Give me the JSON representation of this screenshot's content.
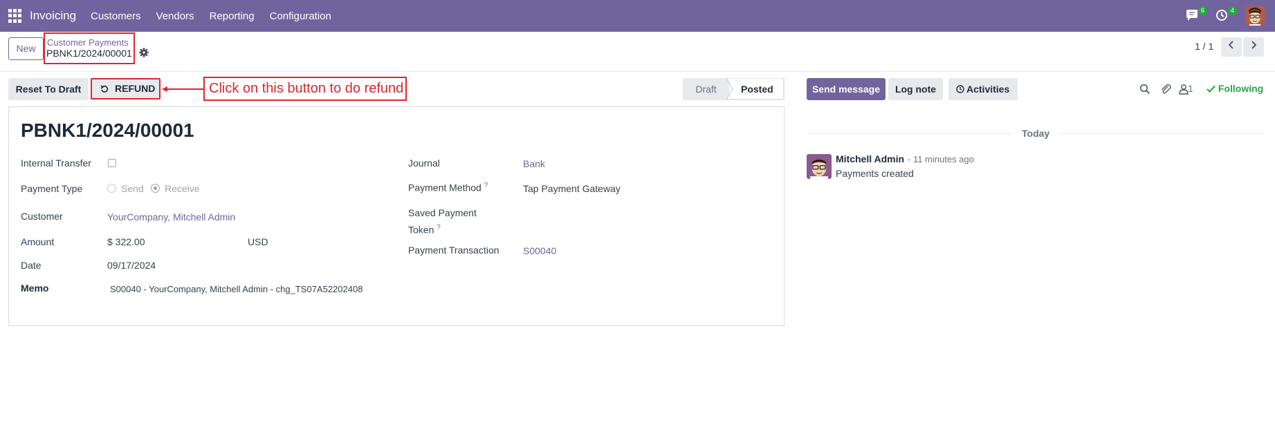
{
  "navbar": {
    "app_name": "Invoicing",
    "menu": [
      "Customers",
      "Vendors",
      "Reporting",
      "Configuration"
    ],
    "messages_badge": "6",
    "activities_badge": "4",
    "bg_color": "#71639e"
  },
  "control_panel": {
    "new_label": "New",
    "breadcrumb_parent": "Customer Payments",
    "breadcrumb_current": "PBNK1/2024/00001",
    "pager": "1 / 1"
  },
  "status_bar": {
    "reset_label": "Reset To Draft",
    "refund_label": "REFUND",
    "annotation": "Click on this button to do refund",
    "stages": [
      "Draft",
      "Posted"
    ],
    "active_stage": "Posted"
  },
  "form": {
    "title": "PBNK1/2024/00001",
    "internal_transfer_label": "Internal Transfer",
    "internal_transfer_checked": false,
    "payment_type_label": "Payment Type",
    "payment_type_options": [
      "Send",
      "Receive"
    ],
    "payment_type_selected": "Receive",
    "customer_label": "Customer",
    "customer_value": "YourCompany, Mitchell Admin",
    "amount_label": "Amount",
    "amount_value": "$ 322.00",
    "currency_value": "USD",
    "date_label": "Date",
    "date_value": "09/17/2024",
    "memo_label": "Memo",
    "memo_value": "S00040 - YourCompany, Mitchell Admin - chg_TS07A52202408",
    "journal_label": "Journal",
    "journal_value": "Bank",
    "payment_method_label": "Payment Method",
    "payment_method_value": "Tap Payment Gateway",
    "saved_token_label_line1": "Saved Payment",
    "saved_token_label_line2": "Token",
    "payment_transaction_label": "Payment Transaction",
    "payment_transaction_value": "S00040",
    "help_mark": "?"
  },
  "chatter": {
    "send_message_label": "Send message",
    "log_note_label": "Log note",
    "activities_label": "Activities",
    "followers_count": "1",
    "following_label": "Following",
    "date_separator": "Today",
    "message": {
      "author": "Mitchell Admin",
      "time": "- 11 minutes ago",
      "body": "Payments created"
    }
  },
  "colors": {
    "accent": "#71639e",
    "annotation_red": "#e0242d",
    "success_green": "#28a745"
  }
}
